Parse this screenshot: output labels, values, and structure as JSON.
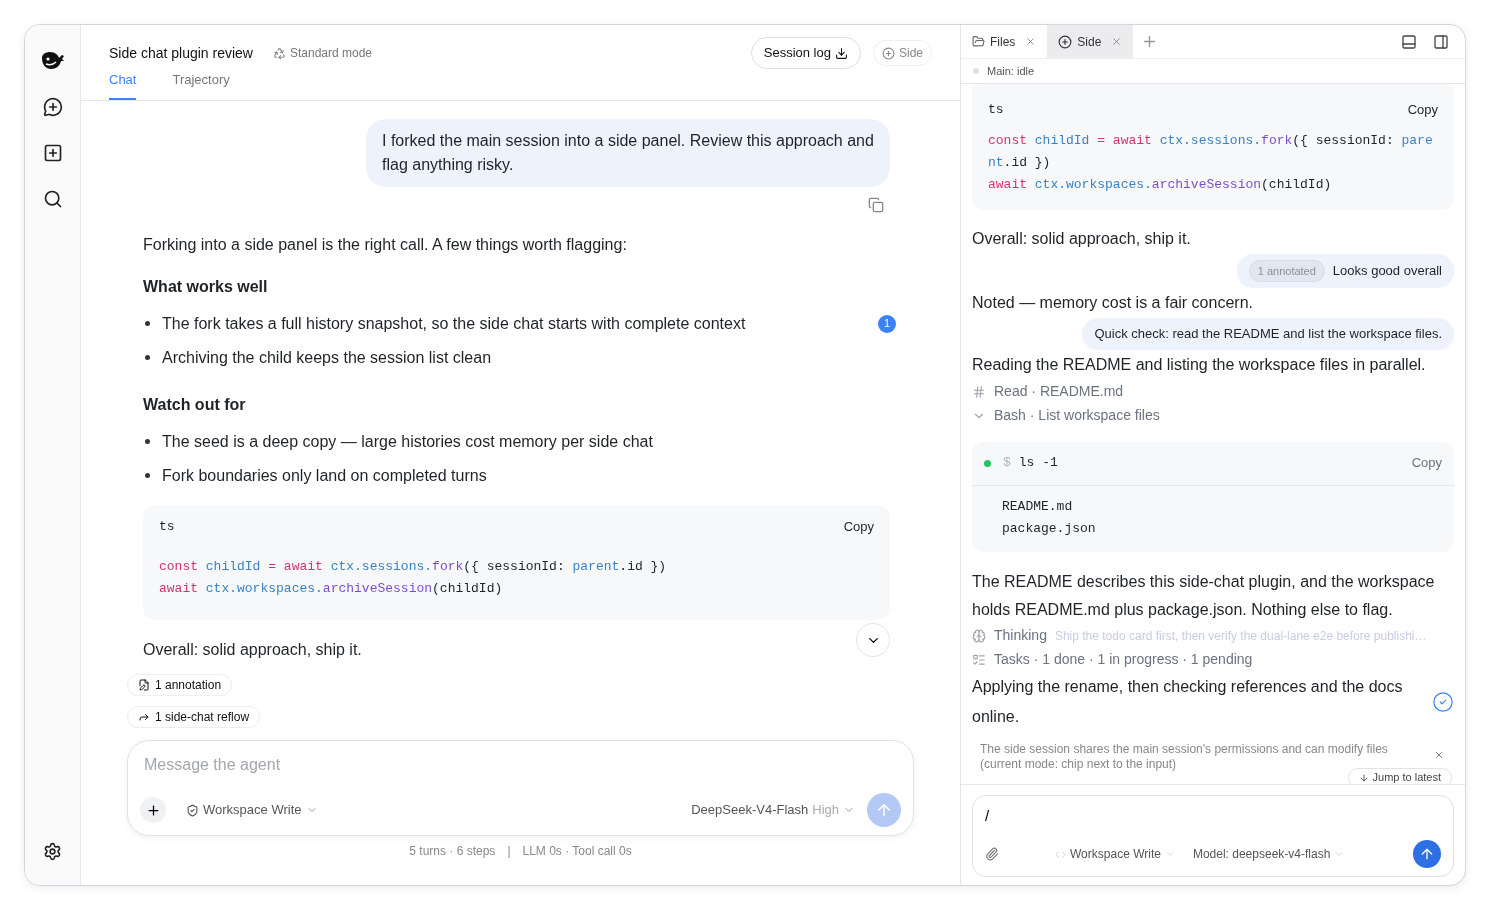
{
  "header": {
    "title": "Side chat plugin review",
    "mode": "Standard mode",
    "buttons": [
      {
        "label": "Session log",
        "kind": "download"
      },
      {
        "label": "Side",
        "kind": "add"
      }
    ]
  },
  "tabs": [
    {
      "label": "Chat",
      "selected": true
    },
    {
      "label": "Trajectory",
      "selected": false
    }
  ],
  "chat": {
    "user_message": "I forked the main session into a side panel. Review this approach and flag anything risky.",
    "intro": "Forking into a side panel is the right call. A few things worth flagging:",
    "sections": [
      {
        "heading": "What works well",
        "bullets": [
          {
            "text": "The fork takes a full history snapshot, so the side chat starts with complete context",
            "badge": "1"
          },
          {
            "text": "Archiving the child keeps the session list clean"
          }
        ]
      },
      {
        "heading": "Watch out for",
        "bullets": [
          {
            "text": "The seed is a deep copy — large histories cost memory per side chat"
          },
          {
            "text": "Fork boundaries only land on completed turns"
          }
        ]
      }
    ],
    "code": {
      "lang": "ts",
      "copy": "Copy",
      "lines": [
        [
          {
            "text": "const ",
            "kind": "keyword"
          },
          {
            "text": "childId ",
            "kind": "ident"
          },
          {
            "text": "= ",
            "kind": "keyword"
          },
          {
            "text": "await ",
            "kind": "keyword"
          },
          {
            "text": "ctx.sessions.",
            "kind": "ident"
          },
          {
            "text": "fork",
            "kind": "method"
          },
          {
            "text": "({ sessionId: ",
            "kind": "plain"
          },
          {
            "text": "parent",
            "kind": "ident"
          },
          {
            "text": ".id })",
            "kind": "plain"
          }
        ],
        [
          {
            "text": "await ",
            "kind": "keyword"
          },
          {
            "text": "ctx.workspaces.",
            "kind": "ident"
          },
          {
            "text": "archiveSession",
            "kind": "method"
          },
          {
            "text": "(childId)",
            "kind": "plain"
          }
        ]
      ]
    },
    "closing": "Overall: solid approach, ship it.",
    "chips": [
      {
        "label": "1 annotation",
        "kind": "annotation"
      },
      {
        "label": "1 side-chat reflow",
        "kind": "reflow"
      }
    ]
  },
  "composer": {
    "placeholder": "Message the agent",
    "mode": "Workspace Write",
    "model": "DeepSeek-V4-Flash",
    "effort": "High"
  },
  "footer": {
    "stats": "5 turns · 6 steps",
    "separator": "|",
    "timing": "LLM 0s · Tool call 0s"
  },
  "side_panel": {
    "tabs": [
      {
        "label": "Files",
        "kind": "folder",
        "selected": false
      },
      {
        "label": "Side",
        "kind": "side",
        "selected": true
      }
    ],
    "status": "Main: idle",
    "code": {
      "lang": "ts",
      "copy": "Copy",
      "lines": [
        [
          {
            "text": "const ",
            "kind": "keyword"
          },
          {
            "text": "childId ",
            "kind": "ident"
          },
          {
            "text": "= ",
            "kind": "keyword"
          },
          {
            "text": "await ",
            "kind": "keyword"
          },
          {
            "text": "ctx.sessions.",
            "kind": "ident"
          },
          {
            "text": "fork",
            "kind": "method"
          },
          {
            "text": "({ sessionId: ",
            "kind": "plain"
          },
          {
            "text": "parent",
            "kind": "ident"
          },
          {
            "text": ".id })",
            "kind": "plain"
          }
        ],
        [
          {
            "text": "await ",
            "kind": "keyword"
          },
          {
            "text": "ctx.workspaces.",
            "kind": "ident"
          },
          {
            "text": "archiveSession",
            "kind": "method"
          },
          {
            "text": "(childId)",
            "kind": "plain"
          }
        ]
      ]
    },
    "messages": [
      {
        "kind": "assistant",
        "text": "Overall: solid approach, ship it."
      },
      {
        "kind": "user",
        "badge": "1 annotated",
        "text": "Looks good overall"
      },
      {
        "kind": "assistant",
        "text": "Noted — memory cost is a fair concern."
      },
      {
        "kind": "user",
        "text": "Quick check: read the README and list the workspace files."
      },
      {
        "kind": "assistant",
        "text": "Reading the README and listing the workspace files in parallel."
      },
      {
        "kind": "file_tool",
        "text": "Read · README.md"
      },
      {
        "kind": "shell_tool",
        "text": "Bash · List workspace files"
      },
      {
        "kind": "terminal",
        "prompt": "$",
        "command": "ls -1",
        "copy": "Copy",
        "output": [
          "README.md",
          "package.json"
        ]
      },
      {
        "kind": "assistant",
        "text": "The README describes this side-chat plugin, and the workspace holds README.md plus package.json. Nothing else to flag."
      },
      {
        "kind": "thinking",
        "label": "Thinking",
        "text": "Ship the todo card first, then verify the dual-lane e2e before publishi…"
      },
      {
        "kind": "tasks",
        "text": "Tasks · 1 done · 1 in progress · 1 pending"
      },
      {
        "kind": "assistant",
        "text": "Applying the rename, then checking references and the docs online.",
        "done": true
      }
    ],
    "notice": "The side session shares the main session's permissions and can modify files (current mode: chip next to the input)",
    "jump": "Jump to latest",
    "composer": {
      "value": "/",
      "mode": "Workspace Write",
      "model": "Model: deepseek-v4-flash"
    }
  }
}
